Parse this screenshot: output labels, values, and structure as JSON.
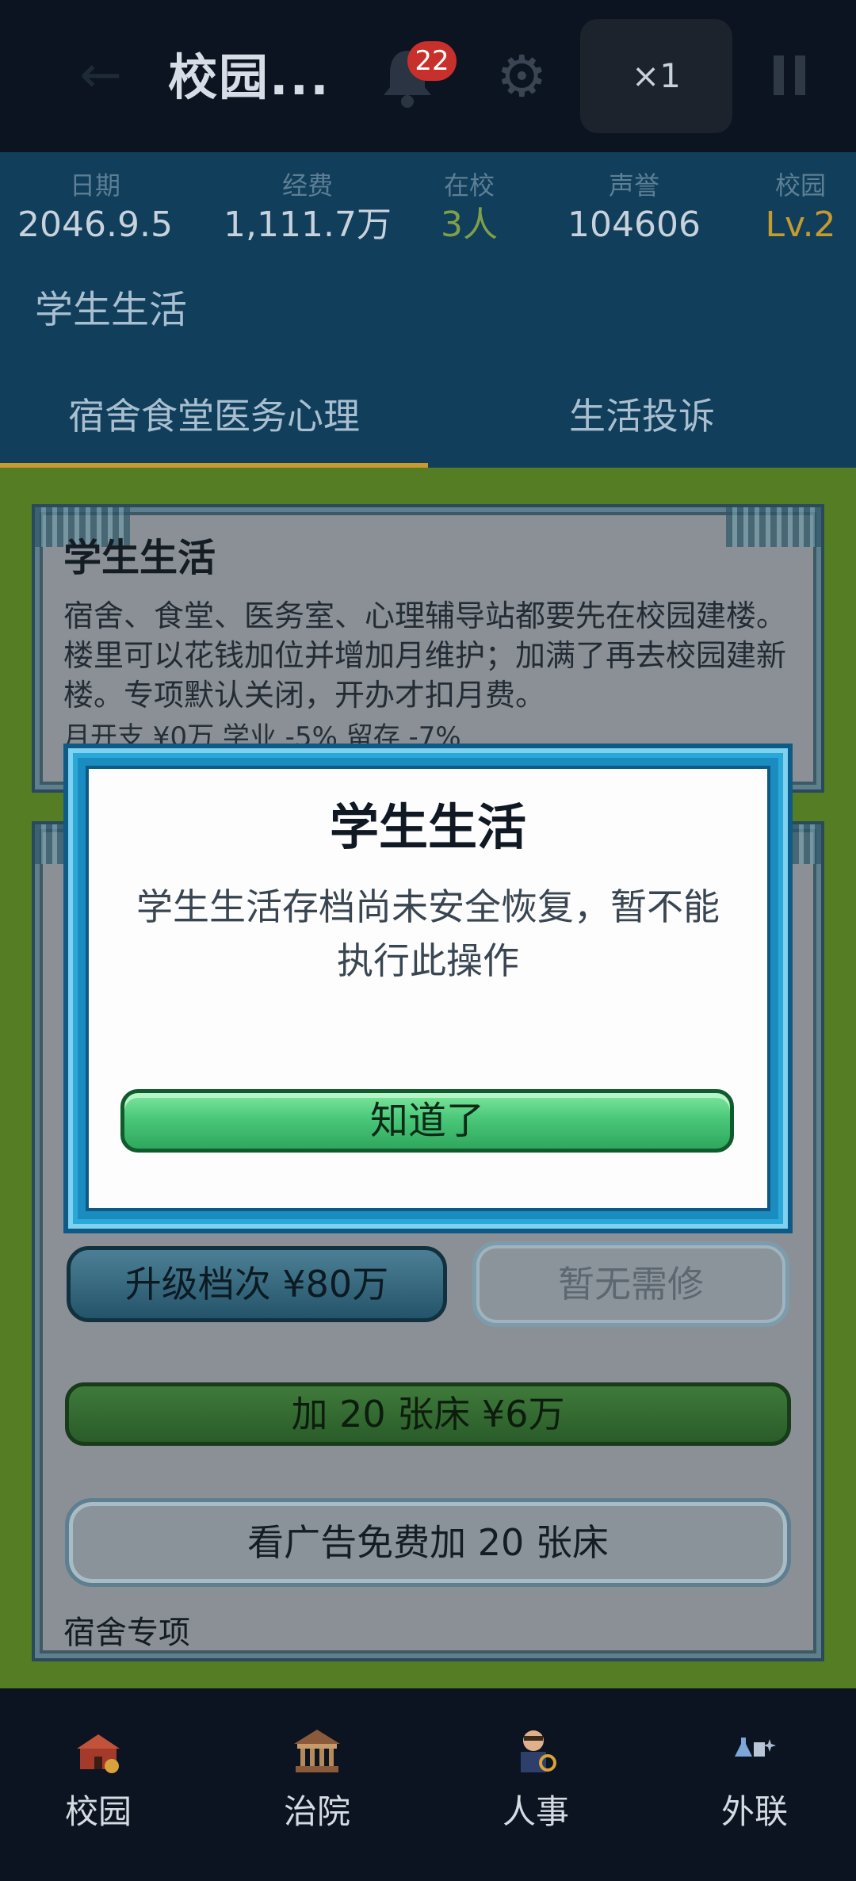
{
  "header": {
    "title": "校园...",
    "notification_count": "22",
    "speed_label": "×1"
  },
  "stats": [
    {
      "label": "日期",
      "value": "2046.9.5",
      "color": "#c8d2dc"
    },
    {
      "label": "经费",
      "value": "1,111.7万",
      "color": "#c8d2dc"
    },
    {
      "label": "在校",
      "value": "3人",
      "color": "#7fa04a"
    },
    {
      "label": "声誉",
      "value": "104606",
      "color": "#c8d2dc"
    },
    {
      "label": "校园",
      "value": "Lv.2",
      "color": "#c59a2e"
    }
  ],
  "section_title": "学生生活",
  "tabs": [
    {
      "label": "宿舍食堂医务心理",
      "active": true
    },
    {
      "label": "生活投诉",
      "active": false
    }
  ],
  "card": {
    "title": "学生生活",
    "text": "宿舍、食堂、医务室、心理辅导站都要先在校园建楼。楼里可以花钱加位并增加月维护；加满了再去校园建新楼。专项默认关闭，开办才扣月费。",
    "cut_line": "月开支 ¥0万   学业 -5%   留存 -7%"
  },
  "actions": {
    "upgrade": "升级档次 ¥80万",
    "repair": "暂无需修",
    "add_beds": "加 20 张床 ¥6万",
    "ad_beds": "看广告免费加 20 张床",
    "dorm_special": "宿舍专项"
  },
  "modal": {
    "title": "学生生活",
    "message": "学生生活存档尚未安全恢复，暂不能执行此操作",
    "confirm": "知道了"
  },
  "nav": [
    {
      "label": "校园",
      "icon": "school-building-icon"
    },
    {
      "label": "治院",
      "icon": "academy-hall-icon"
    },
    {
      "label": "人事",
      "icon": "staff-person-icon"
    },
    {
      "label": "外联",
      "icon": "lab-flasks-icon"
    }
  ]
}
